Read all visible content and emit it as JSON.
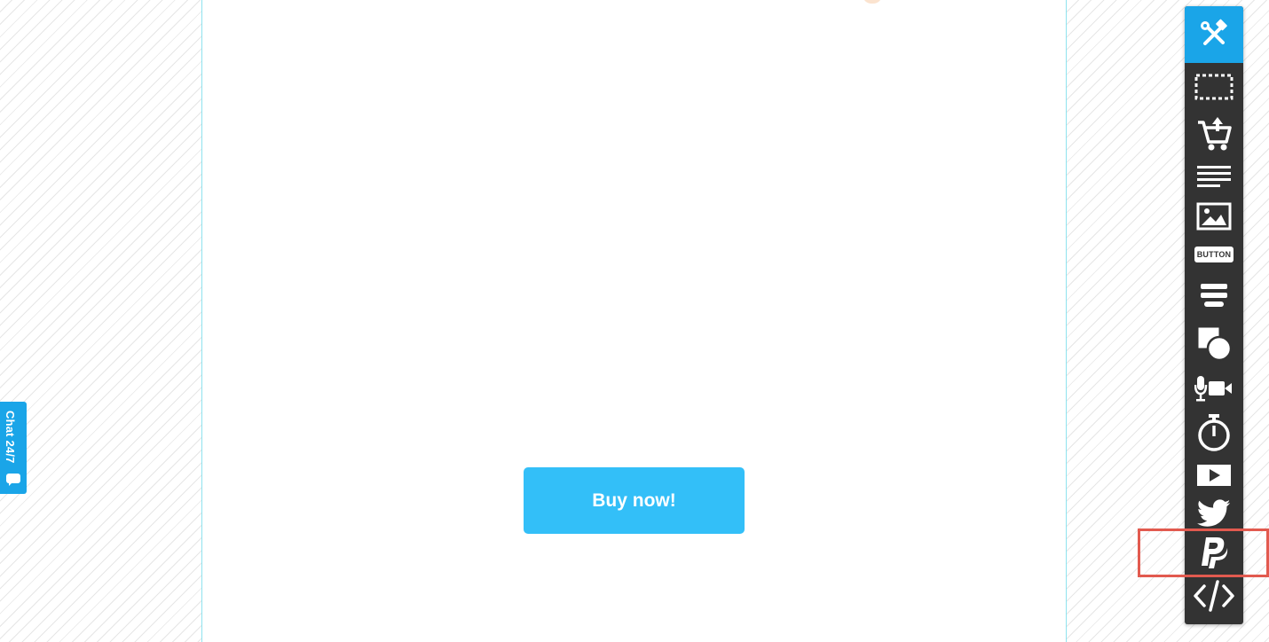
{
  "canvas": {
    "buy_button_label": "Buy now!"
  },
  "chat": {
    "label": "Chat 24/7"
  },
  "toolbar": {
    "button_tool_label": "BUTTON",
    "items": [
      {
        "icon": "tools-icon",
        "active": true
      },
      {
        "icon": "dashed-rectangle-icon"
      },
      {
        "icon": "shopping-cart-icon"
      },
      {
        "icon": "text-lines-icon"
      },
      {
        "icon": "image-icon"
      },
      {
        "icon": "button-icon"
      },
      {
        "icon": "form-fields-icon"
      },
      {
        "icon": "shapes-icon"
      },
      {
        "icon": "microphone-camera-icon"
      },
      {
        "icon": "timer-icon"
      },
      {
        "icon": "video-play-icon"
      },
      {
        "icon": "twitter-icon"
      },
      {
        "icon": "paypal-icon",
        "highlighted": true
      },
      {
        "icon": "code-icon"
      }
    ]
  },
  "colors": {
    "accent": "#1aa5e8",
    "button": "#33bff8",
    "toolbar": "#333333",
    "highlight": "#e25a4f"
  }
}
